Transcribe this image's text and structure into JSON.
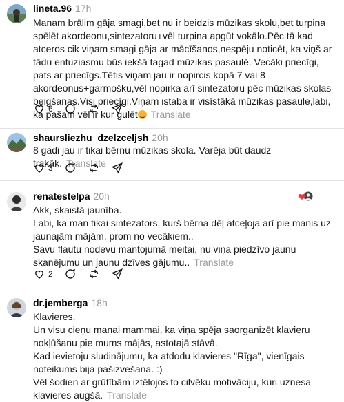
{
  "posts": [
    {
      "username": "lineta.96",
      "time": "17h",
      "text": "Manam brālim gāja smagi,bet nu ir beidzis mūzikas skolu,bet turpina spēlēt akordeonu,sintezatoru+vēl turpina apgūt vokālo.Pēc tā kad atceros cik viņam smagi gāja ar mācīšanos,nespēju noticēt, ka viņš ar tādu entuziasmu būs iekšā tagad mūzikas pasaulē. Vecāki priecīgi, pats ar priecīgs.Tētis viņam jau ir nopircis kopā 7 vai 8 akordeonus+garmošku,vēl nopirka arī sintezatoru pēc mūzikas skolas beigšanas.Visi priecīgi.Viņam istaba ir visīstākā mūzikas pasaule,labi, ka pašam vēl ir kur gulēt",
      "translate": "Translate",
      "likes": "6"
    },
    {
      "username": "shaursliezhu_dzelzceljsh",
      "time": "20h",
      "text": "8 gadi jau ir tikai bērnu mūzikas skola. Varēja būt daudz trakāk.",
      "translate": "Translate",
      "likes": "3"
    },
    {
      "username": "renatestelpa",
      "time": "20h",
      "lines": [
        "Akk, skaistā jaunība.",
        "Labi, ka man tikai sintezators, kurš bērna dēļ atceļoja arī pie manis uz jaunajām mājām, prom no vecākiem..",
        "Savu flautu nodevu mantojumā meitai, nu viņa piedzīvo jaunu skanējumu un jaunu dzīves gājumu.."
      ],
      "translate": "Translate",
      "likes": "2"
    },
    {
      "username": "dr.jemberga",
      "time": "18h",
      "lines": [
        "Klavieres.",
        "Un visu cieņu manai mammai, ka viņa spēja saorganizēt klavieru nokļūšanu pie mums mājās, astotajā stāvā.",
        "Kad ievietoju sludinājumu, ka atdodu klavieres \"Rīga\", vienīgais noteikums bija pašizvešana. :)",
        "Vēl šodien ar grūtībām iztēlojos to cilvēku motivāciju, kuri uznesa klavieres augšā."
      ],
      "translate": "Translate"
    }
  ],
  "icons": {
    "like": "heart-icon",
    "reply": "comment-icon",
    "repost": "repost-icon",
    "share": "share-icon",
    "more": "more-icon"
  }
}
